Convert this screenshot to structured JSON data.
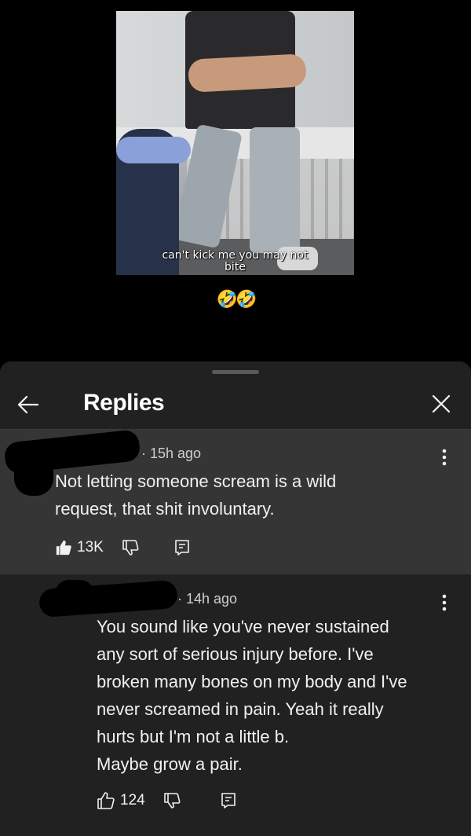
{
  "video": {
    "caption": "can't kick me you may not\nbite",
    "emoji": "🤣🤣"
  },
  "sheet": {
    "title": "Replies"
  },
  "comments": [
    {
      "time": "15h ago",
      "text": "Not letting someone scream is a wild\nrequest, that shit involuntary.",
      "likes": "13K",
      "liked": true
    },
    {
      "time": "14h ago",
      "text": "You sound like you've never sustained\nany sort of serious injury before. I've\nbroken many bones on my body and I've\nnever screamed in pain. Yeah it really\nhurts but I'm not a little b.\nMaybe grow a pair.",
      "likes": "124",
      "liked": false
    }
  ],
  "icons": {
    "back": "back-arrow-icon",
    "close": "close-icon",
    "more": "more-vertical-icon",
    "like": "thumbs-up-icon",
    "dislike": "thumbs-down-icon",
    "reply": "reply-icon"
  }
}
